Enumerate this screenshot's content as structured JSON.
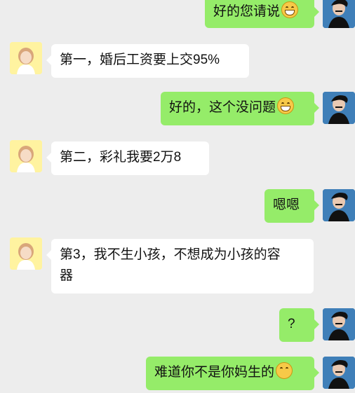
{
  "messages": [
    {
      "side": "right",
      "text": "好的您请说",
      "emoji": "grin-emoji"
    },
    {
      "side": "left",
      "text": "第一，婚后工资要上交95%"
    },
    {
      "side": "right",
      "text": "好的，这个没问题",
      "emoji": "grin-emoji"
    },
    {
      "side": "left",
      "text": "第二，彩礼我要2万8"
    },
    {
      "side": "right",
      "text": "嗯嗯"
    },
    {
      "side": "left",
      "text_line1": "第3，我不生小孩，不想成为小孩的容",
      "text_line2": "器"
    },
    {
      "side": "right",
      "text": "?"
    },
    {
      "side": "right",
      "text": "难道你不是你妈生的",
      "emoji": "confused-emoji"
    }
  ],
  "colors": {
    "bg": "#ededed",
    "self_bubble": "#95ec69",
    "other_bubble": "#ffffff"
  }
}
